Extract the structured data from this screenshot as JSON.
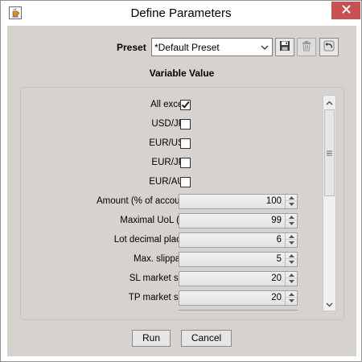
{
  "window": {
    "title": "Define Parameters",
    "close_icon": "close-x-icon",
    "app_icon": "java-cup-icon"
  },
  "preset": {
    "label": "Preset",
    "selected": "*Default Preset",
    "buttons": [
      "save-icon",
      "delete-icon",
      "revert-icon"
    ]
  },
  "section": {
    "title": "Variable Value"
  },
  "checkboxes": [
    {
      "label": "All except",
      "checked": true
    },
    {
      "label": "USD/JPY",
      "checked": false
    },
    {
      "label": "EUR/USD",
      "checked": false
    },
    {
      "label": "EUR/JPY",
      "checked": false
    },
    {
      "label": "EUR/AUD",
      "checked": false
    }
  ],
  "spinners": [
    {
      "label": "Amount (% of account)",
      "value": "100"
    },
    {
      "label": "Maximal UoL (%)",
      "value": "99"
    },
    {
      "label": "Lot decimal places",
      "value": "6"
    },
    {
      "label": "Max. slippage",
      "value": "5"
    },
    {
      "label": "SL market shift",
      "value": "20"
    },
    {
      "label": "TP market shift",
      "value": "20"
    }
  ],
  "actions": {
    "run": "Run",
    "cancel": "Cancel"
  },
  "colors": {
    "client_bg": "#d6d3ce",
    "close_bg": "#c75050"
  }
}
